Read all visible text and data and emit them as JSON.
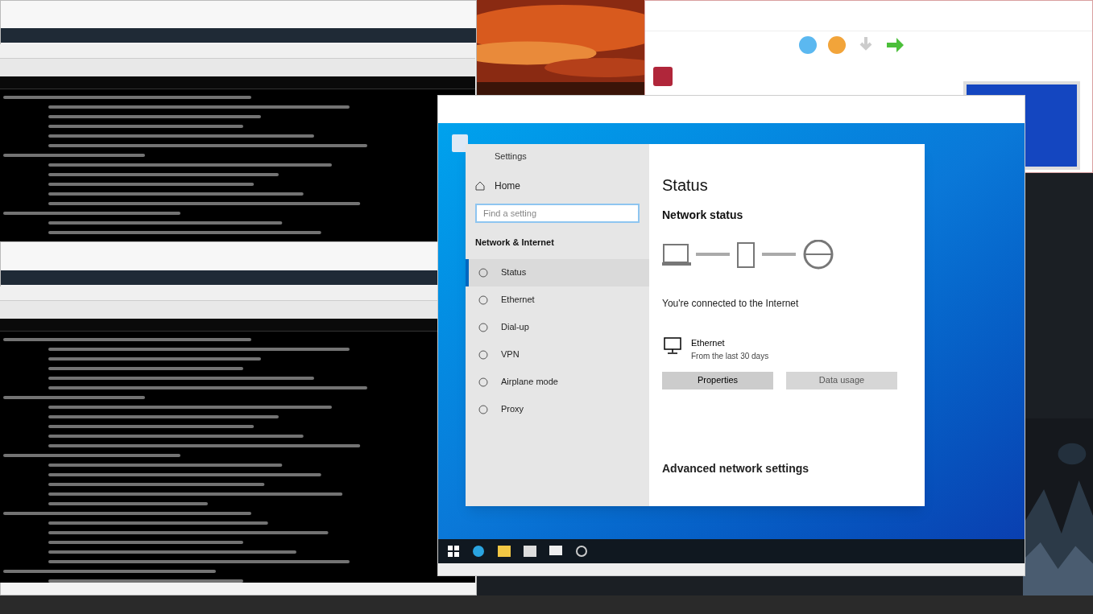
{
  "settings": {
    "title": "Settings",
    "home": "Home",
    "search": {
      "placeholder": "Find a setting"
    },
    "section": "Network & Internet",
    "nav": [
      {
        "label": "Status",
        "selected": true
      },
      {
        "label": "Ethernet",
        "selected": false
      },
      {
        "label": "Dial-up",
        "selected": false
      },
      {
        "label": "VPN",
        "selected": false
      },
      {
        "label": "Airplane mode",
        "selected": false
      },
      {
        "label": "Proxy",
        "selected": false
      }
    ],
    "heading": "Status",
    "subheading": "Network status",
    "connected": "You're connected to the Internet",
    "connection": {
      "name": "Ethernet",
      "usage": "From the last 30 days"
    },
    "buttons": [
      {
        "label": "Properties",
        "kind": "primary"
      },
      {
        "label": "Data usage",
        "kind": "secondary"
      }
    ],
    "advanced": "Advanced network settings"
  }
}
